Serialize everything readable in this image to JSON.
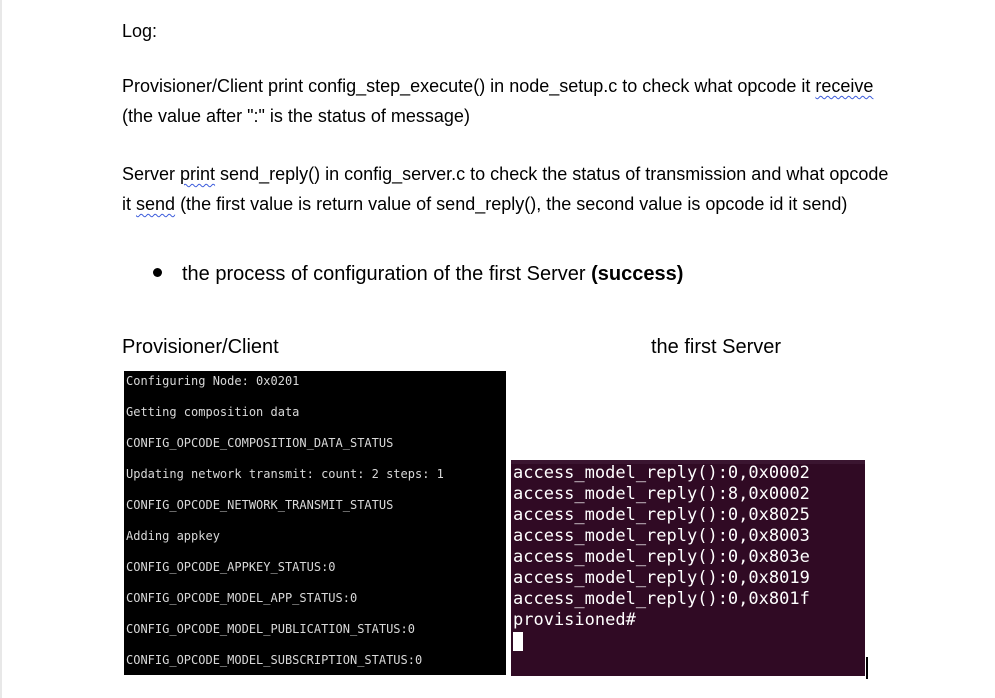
{
  "doc": {
    "log_heading": "Log:",
    "para1": {
      "line1_before": "Provisioner/Client print config_step_execute() in node_setup.c to check what opcode it ",
      "line1_spell": "receive",
      "line2": "(the value after \":\" is the status of message)"
    },
    "para2": {
      "line1_a": "Server ",
      "line1_spell": "print",
      "line1_b": " send_reply() in config_server.c to check the status of transmission and what opcode",
      "line2_a": "it ",
      "line2_spell": "send",
      "line2_b": "  (the first value is return value of send_reply(), the second value is opcode id it send)"
    },
    "bullet": {
      "text": "the process of configuration of the first Server ",
      "bold": "(success)"
    },
    "left_heading": "Provisioner/Client",
    "right_heading": "the first Server"
  },
  "client_terminal": {
    "lines": [
      "Configuring Node: 0x0201",
      "Getting composition data",
      "CONFIG_OPCODE_COMPOSITION_DATA_STATUS",
      "Updating network transmit: count: 2 steps: 1",
      "CONFIG_OPCODE_NETWORK_TRANSMIT_STATUS",
      "Adding appkey",
      "CONFIG_OPCODE_APPKEY_STATUS:0",
      "CONFIG_OPCODE_MODEL_APP_STATUS:0",
      "CONFIG_OPCODE_MODEL_PUBLICATION_STATUS:0",
      "CONFIG_OPCODE_MODEL_SUBSCRIPTION_STATUS:0"
    ]
  },
  "server_terminal": {
    "lines": [
      "access_model_reply():0,0x0002",
      "access_model_reply():8,0x0002",
      "access_model_reply():0,0x8025",
      "access_model_reply():0,0x8003",
      "access_model_reply():0,0x803e",
      "access_model_reply():0,0x8019",
      "access_model_reply():0,0x801f",
      "provisioned#"
    ]
  },
  "colors": {
    "client_terminal_bg": "#000000",
    "server_terminal_bg": "#300a24",
    "spellcheck_underline": "#3b5bdb"
  }
}
